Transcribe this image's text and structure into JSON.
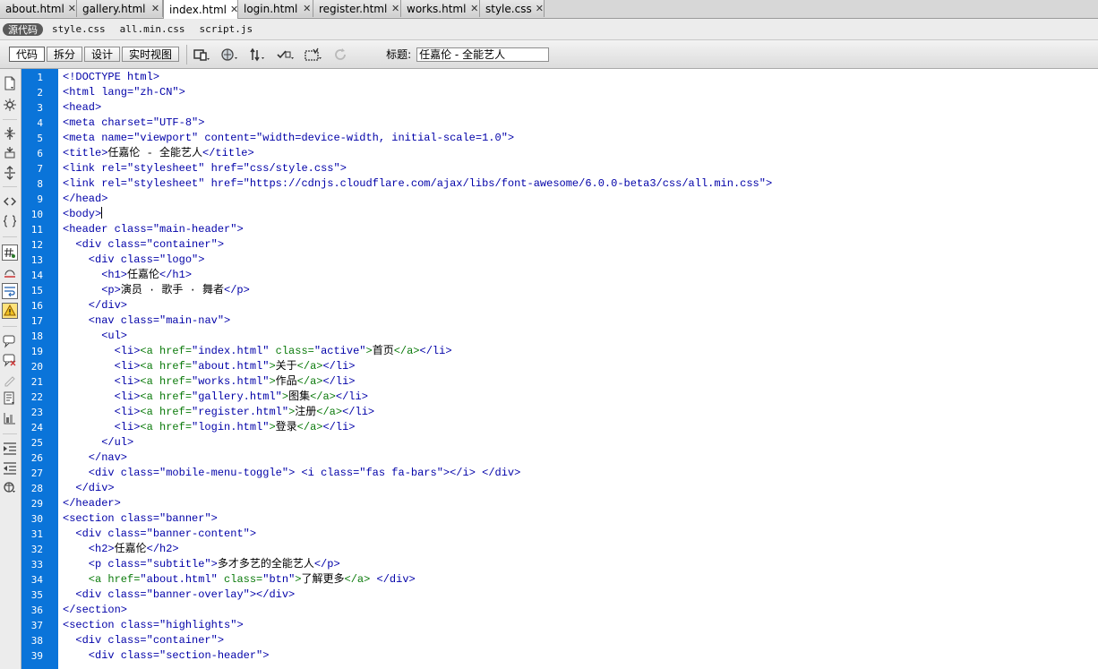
{
  "tabs": [
    {
      "label": "about.html",
      "active": false
    },
    {
      "label": "gallery.html",
      "active": false
    },
    {
      "label": "index.html",
      "active": true
    },
    {
      "label": "login.html",
      "active": false
    },
    {
      "label": "register.html",
      "active": false
    },
    {
      "label": "works.html",
      "active": false
    },
    {
      "label": "style.css",
      "active": false
    }
  ],
  "related_files": {
    "source_label": "源代码",
    "files": [
      "style.css",
      "all.min.css",
      "script.js"
    ]
  },
  "doc_toolbar": {
    "views": [
      "代码",
      "拆分",
      "设计",
      "实时视图"
    ],
    "title_label": "标题:",
    "title_value": "任嘉伦 - 全能艺人",
    "icons": [
      "multiscreen-icon",
      "browser-preview-icon",
      "file-management-icon",
      "validation-icon",
      "visual-aids-icon",
      "refresh-icon"
    ]
  },
  "coding_toolbar_icons": [
    "open-documents-icon",
    "show-code-navigator-icon",
    "collapse-full-tag-icon",
    "collapse-selection-icon",
    "expand-all-icon",
    "select-parent-tag-icon",
    "balance-braces-icon",
    "line-numbers-icon",
    "highlight-invalid-code-icon",
    "word-wrap-icon",
    "syntax-error-alerts-icon",
    "apply-comment-icon",
    "remove-comment-icon",
    "wrap-tag-icon",
    "recent-snippets-icon",
    "move-css-icon",
    "indent-code-icon",
    "outdent-code-icon",
    "format-source-code-icon"
  ],
  "code": {
    "line_numbers": [
      1,
      2,
      3,
      4,
      5,
      6,
      7,
      8,
      9,
      10,
      11,
      12,
      13,
      14,
      15,
      16,
      17,
      18,
      19,
      20,
      21,
      22,
      23,
      24,
      25,
      26,
      27,
      28,
      29,
      30,
      31,
      32,
      33,
      34,
      35,
      36,
      37,
      38,
      39
    ],
    "lines": [
      [
        [
          "t",
          "<!DOCTYPE html>"
        ]
      ],
      [
        [
          "t",
          "<html lang="
        ],
        [
          "s",
          "\"zh-CN\""
        ],
        [
          "t",
          ">"
        ]
      ],
      [
        [
          "t",
          "<head>"
        ]
      ],
      [
        [
          "t",
          "<meta charset="
        ],
        [
          "s",
          "\"UTF-8\""
        ],
        [
          "t",
          ">"
        ]
      ],
      [
        [
          "t",
          "<meta name="
        ],
        [
          "s",
          "\"viewport\""
        ],
        [
          "t",
          " content="
        ],
        [
          "s",
          "\"width=device-width, initial-scale=1.0\""
        ],
        [
          "t",
          ">"
        ]
      ],
      [
        [
          "t",
          "<title>"
        ],
        [
          "x",
          "任嘉伦 - 全能艺人"
        ],
        [
          "t",
          "</title>"
        ]
      ],
      [
        [
          "t",
          "<link rel="
        ],
        [
          "s",
          "\"stylesheet\""
        ],
        [
          "t",
          " href="
        ],
        [
          "s",
          "\"css/style.css\""
        ],
        [
          "t",
          ">"
        ]
      ],
      [
        [
          "t",
          "<link rel="
        ],
        [
          "s",
          "\"stylesheet\""
        ],
        [
          "t",
          " href="
        ],
        [
          "s",
          "\"https://cdnjs.cloudflare.com/ajax/libs/font-awesome/6.0.0-beta3/css/all.min.css\""
        ],
        [
          "t",
          ">"
        ]
      ],
      [
        [
          "t",
          "</head>"
        ]
      ],
      [
        [
          "t",
          "<body>"
        ],
        [
          "caret",
          ""
        ]
      ],
      [
        [
          "t",
          "<header class="
        ],
        [
          "s",
          "\"main-header\""
        ],
        [
          "t",
          ">"
        ]
      ],
      [
        [
          "t",
          "  <div class="
        ],
        [
          "s",
          "\"container\""
        ],
        [
          "t",
          ">"
        ]
      ],
      [
        [
          "t",
          "    <div class="
        ],
        [
          "s",
          "\"logo\""
        ],
        [
          "t",
          ">"
        ]
      ],
      [
        [
          "t",
          "      <h1>"
        ],
        [
          "x",
          "任嘉伦"
        ],
        [
          "t",
          "</h1>"
        ]
      ],
      [
        [
          "t",
          "      <p>"
        ],
        [
          "x",
          "演员 · 歌手 · 舞者"
        ],
        [
          "t",
          "</p>"
        ]
      ],
      [
        [
          "t",
          "    </div>"
        ]
      ],
      [
        [
          "t",
          "    <nav class="
        ],
        [
          "s",
          "\"main-nav\""
        ],
        [
          "t",
          ">"
        ]
      ],
      [
        [
          "t",
          "      <ul>"
        ]
      ],
      [
        [
          "t",
          "        <li>"
        ],
        [
          "g",
          "<a href="
        ],
        [
          "s",
          "\"index.html\""
        ],
        [
          "g",
          " class="
        ],
        [
          "s",
          "\"active\""
        ],
        [
          "g",
          ">"
        ],
        [
          "x",
          "首页"
        ],
        [
          "g",
          "</a>"
        ],
        [
          "t",
          "</li>"
        ]
      ],
      [
        [
          "t",
          "        <li>"
        ],
        [
          "g",
          "<a href="
        ],
        [
          "s",
          "\"about.html\""
        ],
        [
          "g",
          ">"
        ],
        [
          "x",
          "关于"
        ],
        [
          "g",
          "</a>"
        ],
        [
          "t",
          "</li>"
        ]
      ],
      [
        [
          "t",
          "        <li>"
        ],
        [
          "g",
          "<a href="
        ],
        [
          "s",
          "\"works.html\""
        ],
        [
          "g",
          ">"
        ],
        [
          "x",
          "作品"
        ],
        [
          "g",
          "</a>"
        ],
        [
          "t",
          "</li>"
        ]
      ],
      [
        [
          "t",
          "        <li>"
        ],
        [
          "g",
          "<a href="
        ],
        [
          "s",
          "\"gallery.html\""
        ],
        [
          "g",
          ">"
        ],
        [
          "x",
          "图集"
        ],
        [
          "g",
          "</a>"
        ],
        [
          "t",
          "</li>"
        ]
      ],
      [
        [
          "t",
          "        <li>"
        ],
        [
          "g",
          "<a href="
        ],
        [
          "s",
          "\"register.html\""
        ],
        [
          "g",
          ">"
        ],
        [
          "x",
          "注册"
        ],
        [
          "g",
          "</a>"
        ],
        [
          "t",
          "</li>"
        ]
      ],
      [
        [
          "t",
          "        <li>"
        ],
        [
          "g",
          "<a href="
        ],
        [
          "s",
          "\"login.html\""
        ],
        [
          "g",
          ">"
        ],
        [
          "x",
          "登录"
        ],
        [
          "g",
          "</a>"
        ],
        [
          "t",
          "</li>"
        ]
      ],
      [
        [
          "t",
          "      </ul>"
        ]
      ],
      [
        [
          "t",
          "    </nav>"
        ]
      ],
      [
        [
          "t",
          "    <div class="
        ],
        [
          "s",
          "\"mobile-menu-toggle\""
        ],
        [
          "t",
          "> <i class="
        ],
        [
          "s",
          "\"fas fa-bars\""
        ],
        [
          "t",
          "></i> </div>"
        ]
      ],
      [
        [
          "t",
          "  </div>"
        ]
      ],
      [
        [
          "t",
          "</header>"
        ]
      ],
      [
        [
          "t",
          "<section class="
        ],
        [
          "s",
          "\"banner\""
        ],
        [
          "t",
          ">"
        ]
      ],
      [
        [
          "t",
          "  <div class="
        ],
        [
          "s",
          "\"banner-content\""
        ],
        [
          "t",
          ">"
        ]
      ],
      [
        [
          "t",
          "    <h2>"
        ],
        [
          "x",
          "任嘉伦"
        ],
        [
          "t",
          "</h2>"
        ]
      ],
      [
        [
          "t",
          "    <p class="
        ],
        [
          "s",
          "\"subtitle\""
        ],
        [
          "t",
          ">"
        ],
        [
          "x",
          "多才多艺的全能艺人"
        ],
        [
          "t",
          "</p>"
        ]
      ],
      [
        [
          "g",
          "    <a href="
        ],
        [
          "s",
          "\"about.html\""
        ],
        [
          "g",
          " class="
        ],
        [
          "s",
          "\"btn\""
        ],
        [
          "g",
          ">"
        ],
        [
          "x",
          "了解更多"
        ],
        [
          "g",
          "</a>"
        ],
        [
          "t",
          " </div>"
        ]
      ],
      [
        [
          "t",
          "  <div class="
        ],
        [
          "s",
          "\"banner-overlay\""
        ],
        [
          "t",
          "></div>"
        ]
      ],
      [
        [
          "t",
          "</section>"
        ]
      ],
      [
        [
          "t",
          "<section class="
        ],
        [
          "s",
          "\"highlights\""
        ],
        [
          "t",
          ">"
        ]
      ],
      [
        [
          "t",
          "  <div class="
        ],
        [
          "s",
          "\"container\""
        ],
        [
          "t",
          ">"
        ]
      ],
      [
        [
          "t",
          "    <div class="
        ],
        [
          "s",
          "\"section-header\""
        ],
        [
          "t",
          ">"
        ]
      ]
    ]
  }
}
